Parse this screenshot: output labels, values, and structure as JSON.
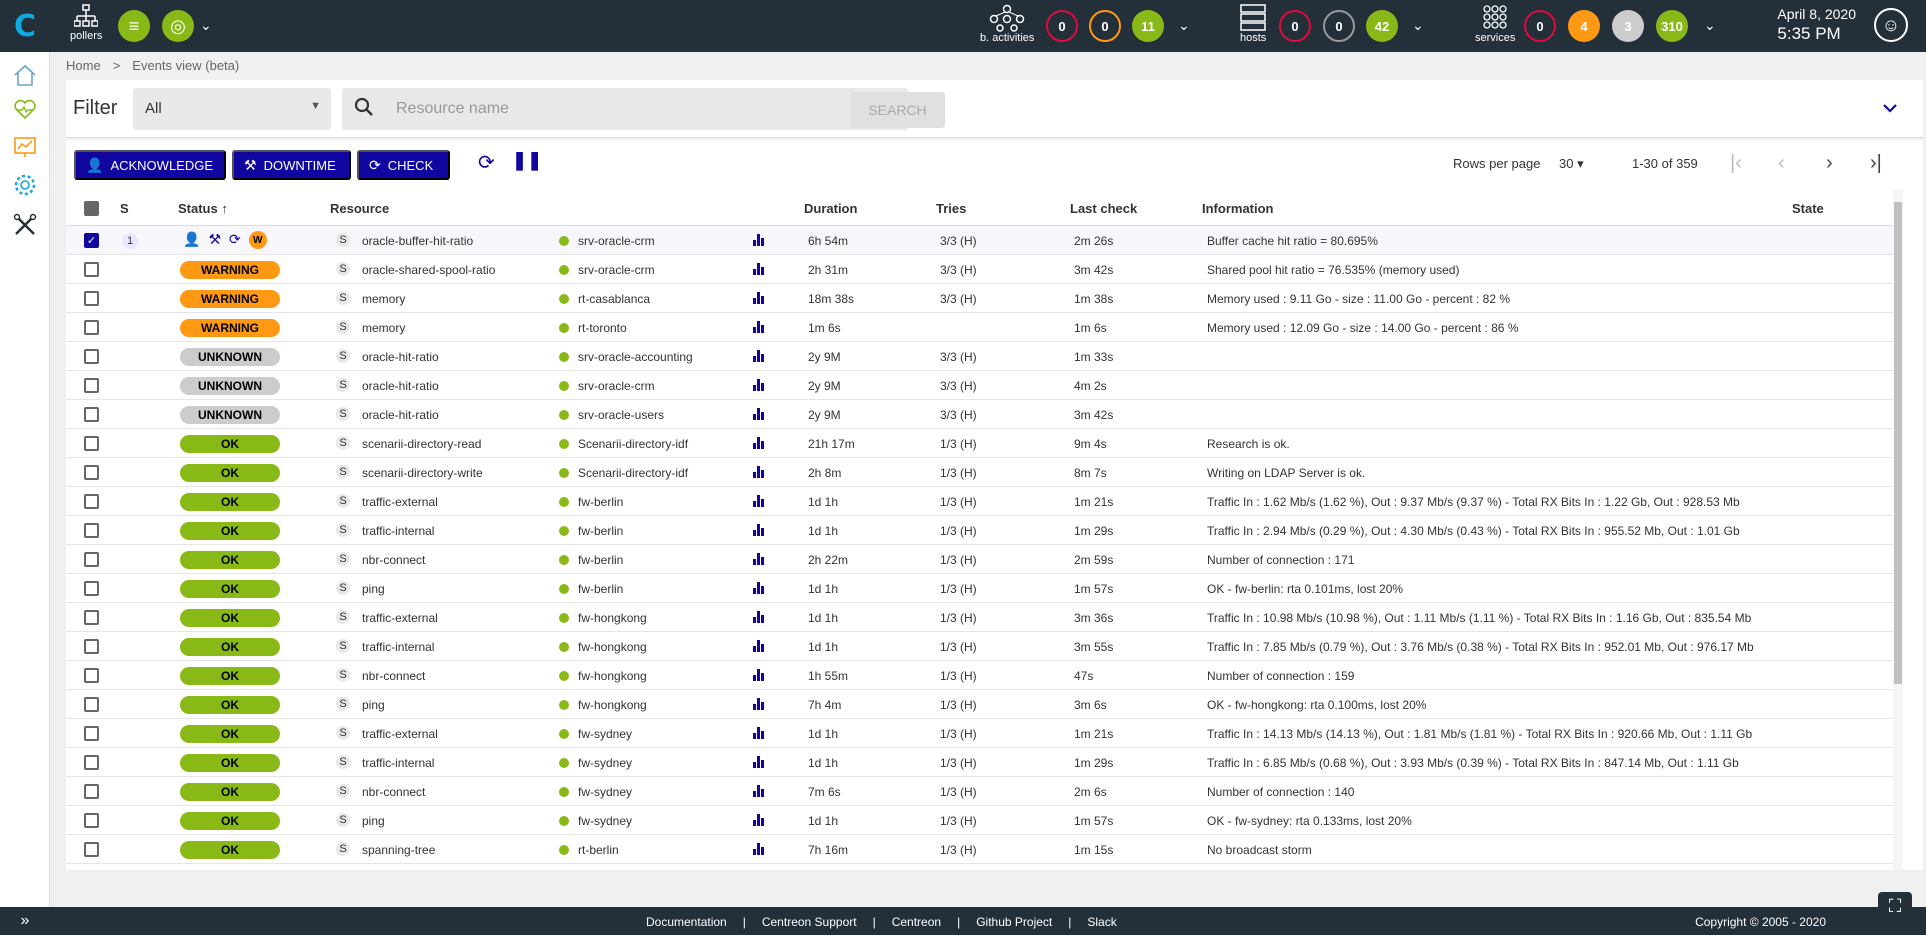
{
  "topbar": {
    "pollers_label": "pollers",
    "activities": {
      "label": "b. activities",
      "critical": "0",
      "warning": "0",
      "ok": "11"
    },
    "hosts": {
      "label": "hosts",
      "down": "0",
      "unreachable": "0",
      "up": "42"
    },
    "services": {
      "label": "services",
      "critical": "0",
      "warning": "4",
      "unknown": "3",
      "ok": "310"
    },
    "date": "April 8, 2020",
    "time": "5:35 PM"
  },
  "breadcrumb": {
    "home": "Home",
    "separator": ">",
    "current": "Events view (beta)"
  },
  "filter": {
    "label": "Filter",
    "selected": "All",
    "search_placeholder": "Resource name",
    "help": "?",
    "search_button": "SEARCH"
  },
  "actions": {
    "acknowledge": "ACKNOWLEDGE",
    "downtime": "DOWNTIME",
    "check": "CHECK"
  },
  "pagination": {
    "rows_per_page_label": "Rows per page",
    "rows_per_page": "30",
    "range": "1-30 of 359"
  },
  "columns": {
    "severity": "S",
    "status": "Status",
    "resource": "Resource",
    "duration": "Duration",
    "tries": "Tries",
    "last_check": "Last check",
    "information": "Information",
    "state": "State"
  },
  "first_row": {
    "severity": "1",
    "resource_type": "S",
    "resource": "oracle-buffer-hit-ratio",
    "parent": "srv-oracle-crm",
    "duration": "6h 54m",
    "tries": "3/3 (H)",
    "last_check": "2m 26s",
    "information": "Buffer cache hit ratio = 80.695%",
    "state_badge": "W"
  },
  "rows": [
    {
      "status": "WARNING",
      "cls": "warning",
      "type": "S",
      "resource": "oracle-shared-spool-ratio",
      "parent": "srv-oracle-crm",
      "duration": "2h 31m",
      "tries": "3/3 (H)",
      "last_check": "3m 42s",
      "info": "Shared pool hit ratio = 76.535% (memory used)"
    },
    {
      "status": "WARNING",
      "cls": "warning",
      "type": "S",
      "resource": "memory",
      "parent": "rt-casablanca",
      "duration": "18m 38s",
      "tries": "3/3 (H)",
      "last_check": "1m 38s",
      "info": "Memory used : 9.11 Go - size : 11.00 Go - percent : 82 %"
    },
    {
      "status": "WARNING",
      "cls": "warning",
      "type": "S",
      "resource": "memory",
      "parent": "rt-toronto",
      "duration": "1m 6s",
      "tries": "",
      "last_check": "1m 6s",
      "info": "Memory used : 12.09 Go - size : 14.00 Go - percent : 86 %"
    },
    {
      "status": "UNKNOWN",
      "cls": "unknown",
      "type": "S",
      "resource": "oracle-hit-ratio",
      "parent": "srv-oracle-accounting",
      "duration": "2y 9M",
      "tries": "3/3 (H)",
      "last_check": "1m 33s",
      "info": ""
    },
    {
      "status": "UNKNOWN",
      "cls": "unknown",
      "type": "S",
      "resource": "oracle-hit-ratio",
      "parent": "srv-oracle-crm",
      "duration": "2y 9M",
      "tries": "3/3 (H)",
      "last_check": "4m 2s",
      "info": ""
    },
    {
      "status": "UNKNOWN",
      "cls": "unknown",
      "type": "S",
      "resource": "oracle-hit-ratio",
      "parent": "srv-oracle-users",
      "duration": "2y 9M",
      "tries": "3/3 (H)",
      "last_check": "3m 42s",
      "info": ""
    },
    {
      "status": "OK",
      "cls": "ok",
      "type": "S",
      "resource": "scenarii-directory-read",
      "parent": "Scenarii-directory-idf",
      "duration": "21h 17m",
      "tries": "1/3 (H)",
      "last_check": "9m 4s",
      "info": "Research is ok."
    },
    {
      "status": "OK",
      "cls": "ok",
      "type": "S",
      "resource": "scenarii-directory-write",
      "parent": "Scenarii-directory-idf",
      "duration": "2h 8m",
      "tries": "1/3 (H)",
      "last_check": "8m 7s",
      "info": "Writing on LDAP Server is ok."
    },
    {
      "status": "OK",
      "cls": "ok",
      "type": "S",
      "resource": "traffic-external",
      "parent": "fw-berlin",
      "duration": "1d 1h",
      "tries": "1/3 (H)",
      "last_check": "1m 21s",
      "info": "Traffic In : 1.62 Mb/s (1.62 %), Out : 9.37 Mb/s (9.37 %) - Total RX Bits In : 1.22 Gb, Out : 928.53 Mb"
    },
    {
      "status": "OK",
      "cls": "ok",
      "type": "S",
      "resource": "traffic-internal",
      "parent": "fw-berlin",
      "duration": "1d 1h",
      "tries": "1/3 (H)",
      "last_check": "1m 29s",
      "info": "Traffic In : 2.94 Mb/s (0.29 %), Out : 4.30 Mb/s (0.43 %) - Total RX Bits In : 955.52 Mb, Out : 1.01 Gb"
    },
    {
      "status": "OK",
      "cls": "ok",
      "type": "S",
      "resource": "nbr-connect",
      "parent": "fw-berlin",
      "duration": "2h 22m",
      "tries": "1/3 (H)",
      "last_check": "2m 59s",
      "info": "Number of connection : 171"
    },
    {
      "status": "OK",
      "cls": "ok",
      "type": "S",
      "resource": "ping",
      "parent": "fw-berlin",
      "duration": "1d 1h",
      "tries": "1/3 (H)",
      "last_check": "1m 57s",
      "info": "OK - fw-berlin: rta 0.101ms, lost 20%"
    },
    {
      "status": "OK",
      "cls": "ok",
      "type": "S",
      "resource": "traffic-external",
      "parent": "fw-hongkong",
      "duration": "1d 1h",
      "tries": "1/3 (H)",
      "last_check": "3m 36s",
      "info": "Traffic In : 10.98 Mb/s (10.98 %), Out : 1.11 Mb/s (1.11 %) - Total RX Bits In : 1.16 Gb, Out : 835.54 Mb"
    },
    {
      "status": "OK",
      "cls": "ok",
      "type": "S",
      "resource": "traffic-internal",
      "parent": "fw-hongkong",
      "duration": "1d 1h",
      "tries": "1/3 (H)",
      "last_check": "3m 55s",
      "info": "Traffic In : 7.85 Mb/s (0.79 %), Out : 3.76 Mb/s (0.38 %) - Total RX Bits In : 952.01 Mb, Out : 976.17 Mb"
    },
    {
      "status": "OK",
      "cls": "ok",
      "type": "S",
      "resource": "nbr-connect",
      "parent": "fw-hongkong",
      "duration": "1h 55m",
      "tries": "1/3 (H)",
      "last_check": "47s",
      "info": "Number of connection : 159"
    },
    {
      "status": "OK",
      "cls": "ok",
      "type": "S",
      "resource": "ping",
      "parent": "fw-hongkong",
      "duration": "7h 4m",
      "tries": "1/3 (H)",
      "last_check": "3m 6s",
      "info": "OK - fw-hongkong: rta 0.100ms, lost 20%"
    },
    {
      "status": "OK",
      "cls": "ok",
      "type": "S",
      "resource": "traffic-external",
      "parent": "fw-sydney",
      "duration": "1d 1h",
      "tries": "1/3 (H)",
      "last_check": "1m 21s",
      "info": "Traffic In : 14.13 Mb/s (14.13 %), Out : 1.81 Mb/s (1.81 %) - Total RX Bits In : 920.66 Mb, Out : 1.11 Gb"
    },
    {
      "status": "OK",
      "cls": "ok",
      "type": "S",
      "resource": "traffic-internal",
      "parent": "fw-sydney",
      "duration": "1d 1h",
      "tries": "1/3 (H)",
      "last_check": "1m 29s",
      "info": "Traffic In : 6.85 Mb/s (0.68 %), Out : 3.93 Mb/s (0.39 %) - Total RX Bits In : 847.14 Mb, Out : 1.11 Gb"
    },
    {
      "status": "OK",
      "cls": "ok",
      "type": "S",
      "resource": "nbr-connect",
      "parent": "fw-sydney",
      "duration": "7m 6s",
      "tries": "1/3 (H)",
      "last_check": "2m 6s",
      "info": "Number of connection : 140"
    },
    {
      "status": "OK",
      "cls": "ok",
      "type": "S",
      "resource": "ping",
      "parent": "fw-sydney",
      "duration": "1d 1h",
      "tries": "1/3 (H)",
      "last_check": "1m 57s",
      "info": "OK - fw-sydney: rta 0.133ms, lost 20%"
    },
    {
      "status": "OK",
      "cls": "ok",
      "type": "S",
      "resource": "spanning-tree",
      "parent": "rt-berlin",
      "duration": "7h 16m",
      "tries": "1/3 (H)",
      "last_check": "1m 15s",
      "info": "No broadcast storm"
    }
  ],
  "footer": {
    "links": [
      "Documentation",
      "Centreon Support",
      "Centreon",
      "Github Project",
      "Slack"
    ],
    "separator": "|",
    "copyright": "Copyright © 2005 - 2020"
  },
  "colors": {
    "primary": "#10069f",
    "ok": "#88b917",
    "warning": "#ff9913",
    "critical": "#e00b3d",
    "unknown": "#cccccc",
    "header": "#232f39"
  }
}
